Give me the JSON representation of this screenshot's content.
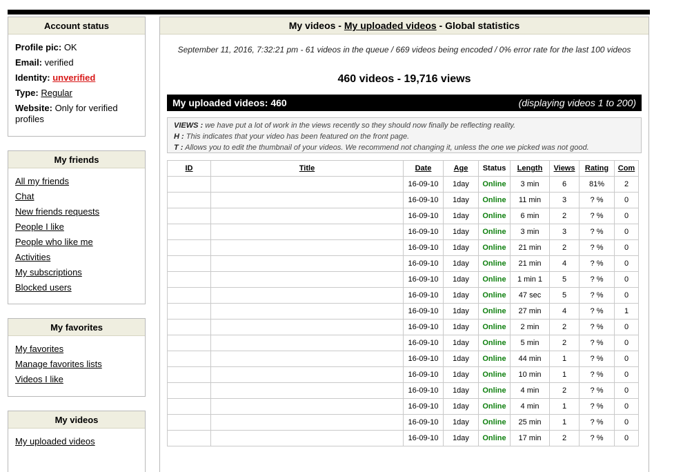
{
  "account": {
    "title": "Account status",
    "profile_pic_label": "Profile pic:",
    "profile_pic_value": "OK",
    "email_label": "Email:",
    "email_value": "verified",
    "identity_label": "Identity:",
    "identity_value": "unverified",
    "type_label": "Type:",
    "type_value": "Regular",
    "website_label": "Website:",
    "website_value": "Only for verified profiles"
  },
  "friends": {
    "title": "My friends",
    "items": [
      "All my friends",
      "Chat",
      "New friends requests",
      "People I like",
      "People who like me",
      "Activities",
      "My subscriptions",
      "Blocked users"
    ]
  },
  "favorites": {
    "title": "My favorites",
    "items": [
      "My favorites",
      "Manage favorites lists",
      "Videos I like"
    ]
  },
  "myvideos": {
    "title": "My videos",
    "items": [
      "My uploaded videos"
    ]
  },
  "main": {
    "title_a": "My videos - ",
    "title_link": "My uploaded videos",
    "title_b": " - Global statistics",
    "stats": "September 11, 2016, 7:32:21 pm - 61 videos in the queue / 669 videos being encoded / 0% error rate for the last 100 videos",
    "summary": "460 videos - 19,716 views",
    "bar_left": "My uploaded videos: 460",
    "bar_right": "(displaying videos 1 to 200)",
    "notes": [
      {
        "key": "VIEWS :",
        "text": " we have put a lot of work in the views recently so they should now finally be reflecting reality."
      },
      {
        "key": "H :",
        "text": " This indicates that your video has been featured on the front page."
      },
      {
        "key": "T :",
        "text": " Allows you to edit the thumbnail of your videos. We recommend not changing it, unless the one we picked was not good."
      }
    ]
  },
  "table": {
    "headers": [
      "ID",
      "Title",
      "Date",
      "Age",
      "Status",
      "Length",
      "Views",
      "Rating",
      "Com"
    ],
    "rows": [
      [
        "16-09-10",
        "1day",
        "Online",
        "3 min",
        "6",
        "81%",
        "2"
      ],
      [
        "16-09-10",
        "1day",
        "Online",
        "11 min",
        "3",
        "? %",
        "0"
      ],
      [
        "16-09-10",
        "1day",
        "Online",
        "6 min",
        "2",
        "? %",
        "0"
      ],
      [
        "16-09-10",
        "1day",
        "Online",
        "3 min",
        "3",
        "? %",
        "0"
      ],
      [
        "16-09-10",
        "1day",
        "Online",
        "21 min",
        "2",
        "? %",
        "0"
      ],
      [
        "16-09-10",
        "1day",
        "Online",
        "21 min",
        "4",
        "? %",
        "0"
      ],
      [
        "16-09-10",
        "1day",
        "Online",
        "1 min 1",
        "5",
        "? %",
        "0"
      ],
      [
        "16-09-10",
        "1day",
        "Online",
        "47 sec",
        "5",
        "? %",
        "0"
      ],
      [
        "16-09-10",
        "1day",
        "Online",
        "27 min",
        "4",
        "? %",
        "1"
      ],
      [
        "16-09-10",
        "1day",
        "Online",
        "2 min",
        "2",
        "? %",
        "0"
      ],
      [
        "16-09-10",
        "1day",
        "Online",
        "5 min",
        "2",
        "? %",
        "0"
      ],
      [
        "16-09-10",
        "1day",
        "Online",
        "44 min",
        "1",
        "? %",
        "0"
      ],
      [
        "16-09-10",
        "1day",
        "Online",
        "10 min",
        "1",
        "? %",
        "0"
      ],
      [
        "16-09-10",
        "1day",
        "Online",
        "4 min",
        "2",
        "? %",
        "0"
      ],
      [
        "16-09-10",
        "1day",
        "Online",
        "4 min",
        "1",
        "? %",
        "0"
      ],
      [
        "16-09-10",
        "1day",
        "Online",
        "25 min",
        "1",
        "? %",
        "0"
      ],
      [
        "16-09-10",
        "1day",
        "Online",
        "17 min",
        "2",
        "? %",
        "0"
      ]
    ]
  },
  "colors": {
    "header_bg": "#efeee0",
    "online": "#108010",
    "unverified": "#d81818"
  }
}
